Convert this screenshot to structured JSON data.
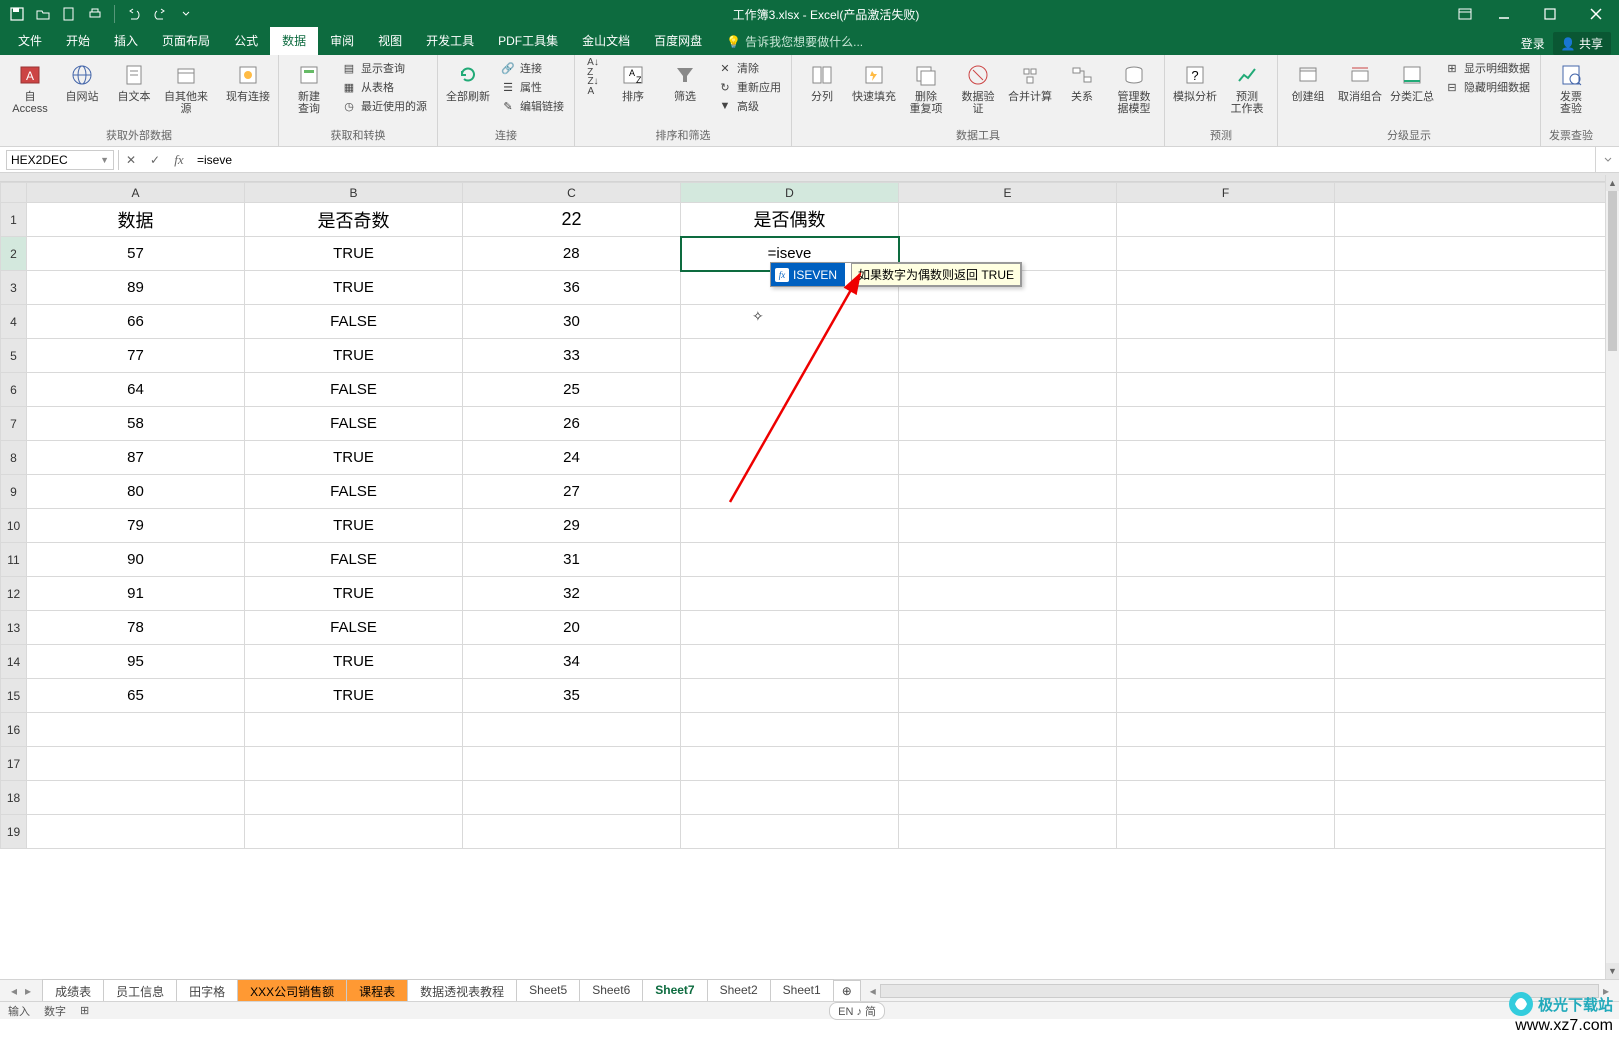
{
  "title": "工作簿3.xlsx - Excel(产品激活失败)",
  "menu": {
    "file": "文件",
    "home": "开始",
    "insert": "插入",
    "layout": "页面布局",
    "formula": "公式",
    "data": "数据",
    "review": "审阅",
    "view": "视图",
    "dev": "开发工具",
    "pdf": "PDF工具集",
    "jsdoc": "金山文档",
    "baidu": "百度网盘",
    "tell": "告诉我您想要做什么...",
    "login": "登录",
    "share": "共享"
  },
  "ribbon": {
    "ext": {
      "access": "自 Access",
      "web": "自网站",
      "text": "自文本",
      "other": "自其他来源",
      "existing": "现有连接",
      "label": "获取外部数据"
    },
    "getq": {
      "query": "新建\n查询",
      "show": "显示查询",
      "table": "从表格",
      "recent": "最近使用的源",
      "label": "获取和转换"
    },
    "conn": {
      "refresh": "全部刷新",
      "conns": "连接",
      "props": "属性",
      "edit": "编辑链接",
      "label": "连接"
    },
    "sort": {
      "az": "",
      "sort": "排序",
      "filter": "筛选",
      "clear": "清除",
      "reapply": "重新应用",
      "adv": "高级",
      "label": "排序和筛选"
    },
    "datatools": {
      "split": "分列",
      "flash": "快速填充",
      "dup": "删除\n重复项",
      "valid": "数据验\n证",
      "consol": "合并计算",
      "rel": "关系",
      "model": "管理数\n据模型",
      "label": "数据工具"
    },
    "forecast": {
      "whatif": "模拟分析",
      "sheet": "预测\n工作表",
      "label": "预测"
    },
    "outline": {
      "group": "创建组",
      "ungroup": "取消组合",
      "subtotal": "分类汇总",
      "showdet": "显示明细数据",
      "hidedet": "隐藏明细数据",
      "label": "分级显示"
    },
    "inv": {
      "check": "发票\n查验",
      "label": "发票查验"
    }
  },
  "formulaBar": {
    "name": "HEX2DEC",
    "value": "=iseve"
  },
  "headers": [
    "A",
    "B",
    "C",
    "D",
    "E",
    "F"
  ],
  "rows": [
    {
      "n": "1",
      "A": "数据",
      "B": "是否奇数",
      "C": "22",
      "D": "是否偶数"
    },
    {
      "n": "2",
      "A": "57",
      "B": "TRUE",
      "C": "28",
      "D": "=iseve"
    },
    {
      "n": "3",
      "A": "89",
      "B": "TRUE",
      "C": "36",
      "D": ""
    },
    {
      "n": "4",
      "A": "66",
      "B": "FALSE",
      "C": "30",
      "D": ""
    },
    {
      "n": "5",
      "A": "77",
      "B": "TRUE",
      "C": "33",
      "D": ""
    },
    {
      "n": "6",
      "A": "64",
      "B": "FALSE",
      "C": "25",
      "D": ""
    },
    {
      "n": "7",
      "A": "58",
      "B": "FALSE",
      "C": "26",
      "D": ""
    },
    {
      "n": "8",
      "A": "87",
      "B": "TRUE",
      "C": "24",
      "D": ""
    },
    {
      "n": "9",
      "A": "80",
      "B": "FALSE",
      "C": "27",
      "D": ""
    },
    {
      "n": "10",
      "A": "79",
      "B": "TRUE",
      "C": "29",
      "D": ""
    },
    {
      "n": "11",
      "A": "90",
      "B": "FALSE",
      "C": "31",
      "D": ""
    },
    {
      "n": "12",
      "A": "91",
      "B": "TRUE",
      "C": "32",
      "D": ""
    },
    {
      "n": "13",
      "A": "78",
      "B": "FALSE",
      "C": "20",
      "D": ""
    },
    {
      "n": "14",
      "A": "95",
      "B": "TRUE",
      "C": "34",
      "D": ""
    },
    {
      "n": "15",
      "A": "65",
      "B": "TRUE",
      "C": "35",
      "D": ""
    },
    {
      "n": "16",
      "A": "",
      "B": "",
      "C": "",
      "D": ""
    },
    {
      "n": "17",
      "A": "",
      "B": "",
      "C": "",
      "D": ""
    },
    {
      "n": "18",
      "A": "",
      "B": "",
      "C": "",
      "D": ""
    },
    {
      "n": "19",
      "A": "",
      "B": "",
      "C": "",
      "D": ""
    }
  ],
  "autocomplete": {
    "fn": "ISEVEN",
    "hint": "如果数字为偶数则返回 TRUE"
  },
  "sheetTabs": [
    "成绩表",
    "员工信息",
    "田字格",
    "XXX公司销售额",
    "课程表",
    "数据透视表教程",
    "Sheet5",
    "Sheet6",
    "Sheet7",
    "Sheet2",
    "Sheet1"
  ],
  "activeSheet": "Sheet7",
  "orangeSheets": [
    "XXX公司销售额",
    "课程表"
  ],
  "status": {
    "input": "输入",
    "num": "数字",
    "calc": "",
    "ime": "EN ♪ 简"
  },
  "watermark": {
    "site": "极光下载站",
    "url": "www.xz7.com"
  }
}
